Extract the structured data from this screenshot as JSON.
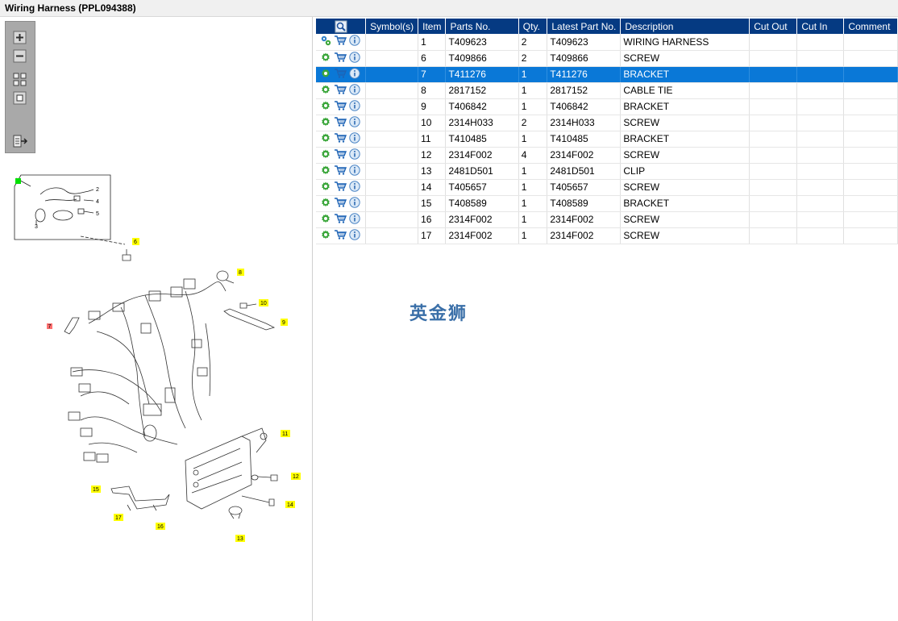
{
  "window": {
    "title": "Wiring Harness (PPL094388)"
  },
  "toolbar": {
    "buttons": [
      "zoom-in",
      "zoom-out",
      "fit-all",
      "fit-page",
      "export"
    ]
  },
  "table": {
    "columns": [
      "Symbol(s)",
      "Item",
      "Parts No.",
      "Qty.",
      "Latest Part No.",
      "Description",
      "Cut Out",
      "Cut In",
      "Comment"
    ],
    "rows": [
      {
        "item": "1",
        "part": "T409623",
        "qty": "2",
        "latest": "T409623",
        "desc": "WIRING HARNESS",
        "selected": false,
        "gear": "gears"
      },
      {
        "item": "6",
        "part": "T409866",
        "qty": "2",
        "latest": "T409866",
        "desc": "SCREW",
        "selected": false,
        "gear": "gear"
      },
      {
        "item": "7",
        "part": "T411276",
        "qty": "1",
        "latest": "T411276",
        "desc": "BRACKET",
        "selected": true,
        "gear": "gear"
      },
      {
        "item": "8",
        "part": "2817152",
        "qty": "1",
        "latest": "2817152",
        "desc": "CABLE TIE",
        "selected": false,
        "gear": "gear"
      },
      {
        "item": "9",
        "part": "T406842",
        "qty": "1",
        "latest": "T406842",
        "desc": "BRACKET",
        "selected": false,
        "gear": "gear"
      },
      {
        "item": "10",
        "part": "2314H033",
        "qty": "2",
        "latest": "2314H033",
        "desc": "SCREW",
        "selected": false,
        "gear": "gear"
      },
      {
        "item": "11",
        "part": "T410485",
        "qty": "1",
        "latest": "T410485",
        "desc": "BRACKET",
        "selected": false,
        "gear": "gear"
      },
      {
        "item": "12",
        "part": "2314F002",
        "qty": "4",
        "latest": "2314F002",
        "desc": "SCREW",
        "selected": false,
        "gear": "gear"
      },
      {
        "item": "13",
        "part": "2481D501",
        "qty": "1",
        "latest": "2481D501",
        "desc": "CLIP",
        "selected": false,
        "gear": "gear"
      },
      {
        "item": "14",
        "part": "T405657",
        "qty": "1",
        "latest": "T405657",
        "desc": "SCREW",
        "selected": false,
        "gear": "gear"
      },
      {
        "item": "15",
        "part": "T408589",
        "qty": "1",
        "latest": "T408589",
        "desc": "BRACKET",
        "selected": false,
        "gear": "gear"
      },
      {
        "item": "16",
        "part": "2314F002",
        "qty": "1",
        "latest": "2314F002",
        "desc": "SCREW",
        "selected": false,
        "gear": "gear"
      },
      {
        "item": "17",
        "part": "2314F002",
        "qty": "1",
        "latest": "2314F002",
        "desc": "SCREW",
        "selected": false,
        "gear": "gear"
      }
    ]
  },
  "diagram": {
    "callouts": {
      "inset": [
        "2",
        "4",
        "5",
        "3"
      ],
      "highlighted_green": "1",
      "highlighted_red": "7",
      "yellow": [
        "6",
        "8",
        "10",
        "9",
        "11",
        "12",
        "14",
        "15",
        "17",
        "16",
        "13"
      ]
    }
  },
  "watermark": "英金狮",
  "colors": {
    "header_bg": "#053a82",
    "selected_row": "#0a78d7",
    "callout_yellow": "#ffff00"
  }
}
